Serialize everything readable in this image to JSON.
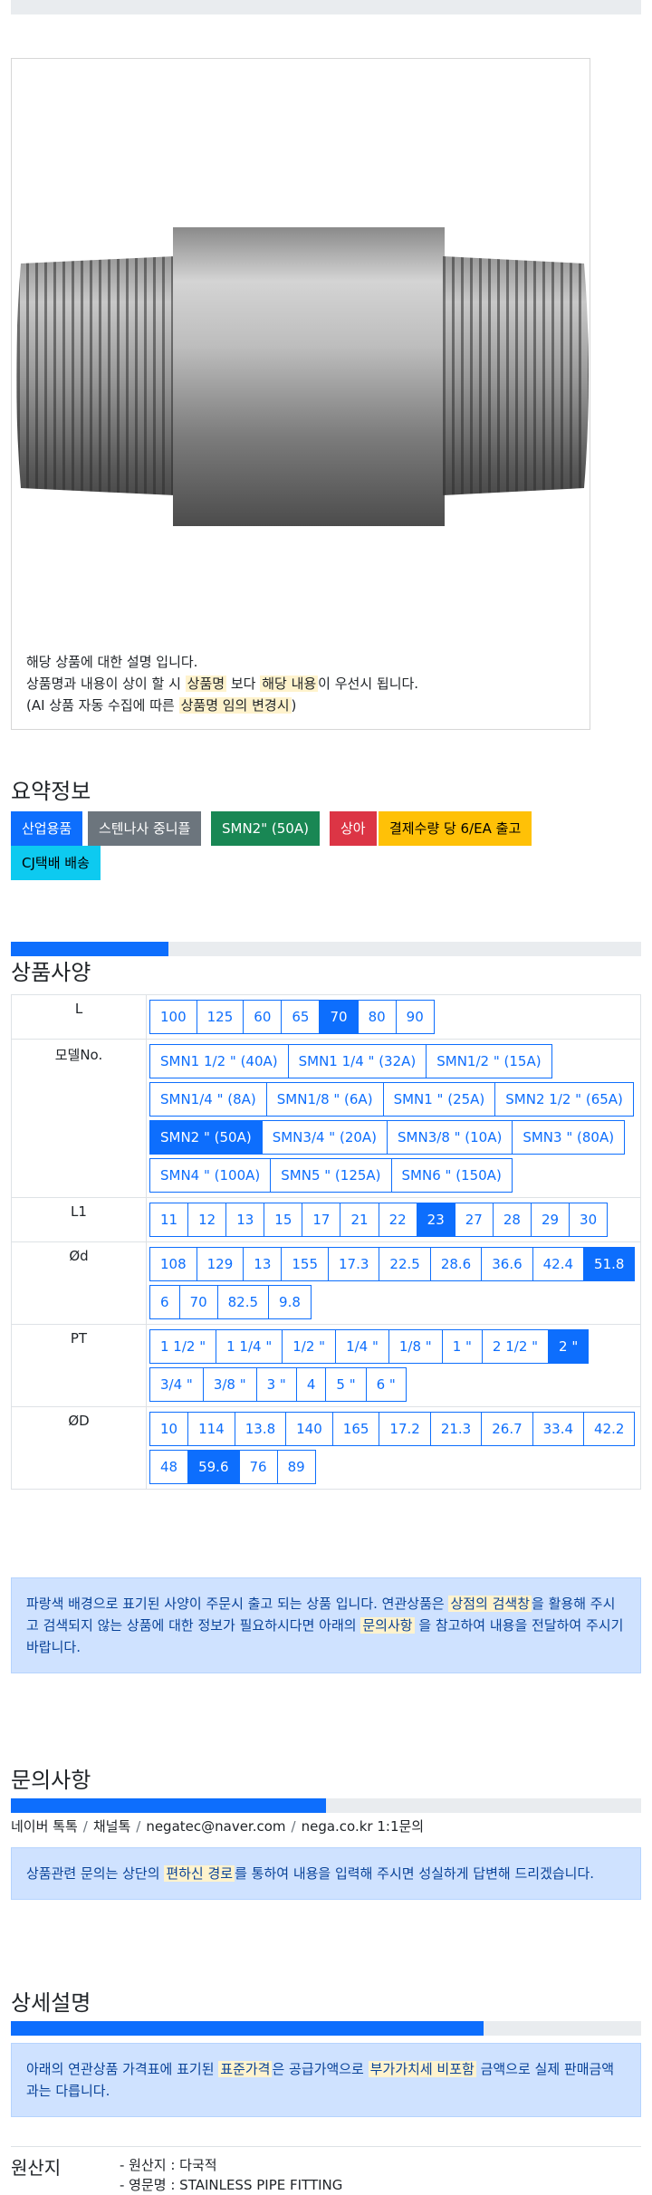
{
  "product": {
    "description_lines": [
      [
        "해당 상품에 대한 설명 입니다."
      ],
      [
        "상품명과 내용이 상이 할 시 ",
        "상품명",
        " 보다 ",
        "해당 내용",
        "이 우선시 됩니다."
      ],
      [
        "(AI 상품 자동 수집에 따른 ",
        "상품명 임의 변경시",
        ")"
      ]
    ]
  },
  "summary": {
    "title": "요약정보",
    "badges": [
      {
        "label": "산업용품",
        "color": "#0d6efd"
      },
      {
        "label": "스텐나사 중니플",
        "color": "#6c757d"
      },
      {
        "label": "SMN2\" (50A)",
        "color": "#198754"
      },
      {
        "label": "상아",
        "color": "#dc3545"
      },
      {
        "label": "결제수량 당 6/EA 출고",
        "color": "#ffc107"
      },
      {
        "label": "CJ택배 배송",
        "color": "#0dcaf0"
      }
    ]
  },
  "spec": {
    "title": "상품사양",
    "progress_pct": 25,
    "rows": [
      {
        "label": "L",
        "chips": [
          "100",
          "125",
          "60",
          "65",
          "70",
          "80",
          "90"
        ],
        "selected": "70"
      },
      {
        "label": "모델No.",
        "chips": [
          "SMN1 1/2 \" (40A)",
          "SMN1 1/4 \" (32A)",
          "SMN1/2 \" (15A)",
          "SMN1/4 \" (8A)",
          "SMN1/8 \" (6A)",
          "SMN1 \" (25A)",
          "SMN2 1/2 \" (65A)",
          "SMN2 \" (50A)",
          "SMN3/4 \" (20A)",
          "SMN3/8 \" (10A)",
          "SMN3 \" (80A)",
          "SMN4 \" (100A)",
          "SMN5 \" (125A)",
          "SMN6 \" (150A)"
        ],
        "selected": "SMN2 \" (50A)"
      },
      {
        "label": "L1",
        "chips": [
          "11",
          "12",
          "13",
          "15",
          "17",
          "21",
          "22",
          "23",
          "27",
          "28",
          "29",
          "30"
        ],
        "selected": "23"
      },
      {
        "label": "Ød",
        "chips": [
          "108",
          "129",
          "13",
          "155",
          "17.3",
          "22.5",
          "28.6",
          "36.6",
          "42.4",
          "51.8",
          "6",
          "70",
          "82.5",
          "9.8"
        ],
        "selected": "51.8"
      },
      {
        "label": "PT",
        "chips": [
          "1 1/2 \"",
          "1 1/4 \"",
          "1/2 \"",
          "1/4 \"",
          "1/8 \"",
          "1 \"",
          "2 1/2 \"",
          "2 \"",
          "3/4 \"",
          "3/8 \"",
          "3 \"",
          "4",
          "5 \"",
          "6 \""
        ],
        "selected": "2 \""
      },
      {
        "label": "ØD",
        "chips": [
          "10",
          "114",
          "13.8",
          "140",
          "165",
          "17.2",
          "21.3",
          "26.7",
          "33.4",
          "42.2",
          "48",
          "59.6",
          "76",
          "89"
        ],
        "selected": "59.6"
      }
    ],
    "note": [
      "파랑색 배경으로 표기된 사양이 주문시 출고 되는 상품 입니다. 연관상품은 ",
      "상점의 검색창",
      "을 활용해 주시고 검색되지 않는 상품에 대한 정보가 필요하시다면 아래의 ",
      "문의사항",
      " 을 참고하여 내용을 전달하여 주시기 바랍니다."
    ]
  },
  "inquiry": {
    "title": "문의사항",
    "progress_pct": 50,
    "contacts": [
      "네이버 톡톡",
      "채널톡",
      "negatec@naver.com",
      "nega.co.kr 1:1문의"
    ],
    "note": [
      "상품관련 문의는 상단의 ",
      "편하신 경로",
      "를 통하여 내용을 입력해 주시면 성실하게 답변해 드리겠습니다."
    ]
  },
  "detail": {
    "title": "상세설명",
    "progress_pct": 75,
    "note": [
      "아래의 연관상품 가격표에 표기된 ",
      "표준가격",
      "은 공급가액으로 ",
      "부가가치세 비포함",
      " 금액으로 실제 판매금액과는 다릅니다."
    ]
  },
  "origin": {
    "title": "원산지",
    "items": [
      "- 원산지 : 다국적",
      "- 영문명 : STAINLESS PIPE FITTING"
    ]
  }
}
